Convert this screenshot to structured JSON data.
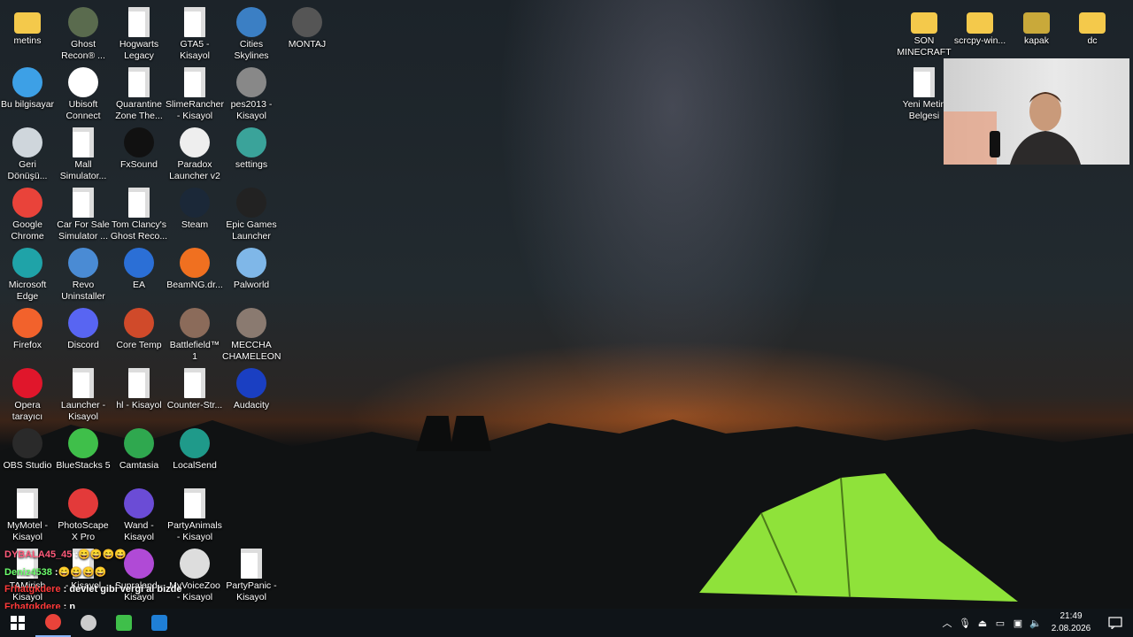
{
  "desktop_icons": [
    {
      "label": "metins",
      "icon": "folder-user-icon",
      "color": "#f4c94b"
    },
    {
      "label": "Ghost\nRecon® ...",
      "icon": "ghost-recon-icon",
      "color": "#5a6b4e"
    },
    {
      "label": "Hogwarts\nLegacy",
      "icon": "shortcut-file-icon",
      "color": "#ffffff"
    },
    {
      "label": "GTA5 -\nKisayol",
      "icon": "shortcut-file-icon",
      "color": "#ffffff"
    },
    {
      "label": "Cities\nSkylines",
      "icon": "cities-skylines-icon",
      "color": "#3b7fc4"
    },
    {
      "label": "MONTAJ",
      "icon": "montaj-icon",
      "color": "#555555"
    },
    {
      "label": "Bu bilgisayar",
      "icon": "computer-icon",
      "color": "#3da0e6"
    },
    {
      "label": "Ubisoft\nConnect",
      "icon": "ubisoft-icon",
      "color": "#ffffff"
    },
    {
      "label": "Quarantine\nZone The...",
      "icon": "shortcut-file-icon",
      "color": "#ffffff"
    },
    {
      "label": "SlimeRancher\n- Kisayol",
      "icon": "shortcut-file-icon",
      "color": "#ffffff"
    },
    {
      "label": "pes2013 -\nKisayol",
      "icon": "pes-icon",
      "color": "#888888"
    },
    {
      "label": "Geri\nDönüşü...",
      "icon": "recycle-bin-icon",
      "color": "#cfd6dc"
    },
    {
      "label": "Mall\nSimulator...",
      "icon": "shortcut-file-icon",
      "color": "#ffffff"
    },
    {
      "label": "FxSound",
      "icon": "fxsound-icon",
      "color": "#111111"
    },
    {
      "label": "Paradox\nLauncher v2",
      "icon": "paradox-icon",
      "color": "#eeeeee"
    },
    {
      "label": "settings",
      "icon": "settings-icon",
      "color": "#3aa39a"
    },
    {
      "label": "Google\nChrome",
      "icon": "chrome-icon",
      "color": "#e9433a"
    },
    {
      "label": "Car For Sale\nSimulator ...",
      "icon": "shortcut-file-icon",
      "color": "#ffffff"
    },
    {
      "label": "Tom Clancy's\nGhost Reco...",
      "icon": "shortcut-file-icon",
      "color": "#ffffff"
    },
    {
      "label": "Steam",
      "icon": "steam-icon",
      "color": "#1b2838"
    },
    {
      "label": "Epic Games\nLauncher",
      "icon": "epic-games-icon",
      "color": "#222222"
    },
    {
      "label": "Microsoft\nEdge",
      "icon": "edge-icon",
      "color": "#1fa3a8"
    },
    {
      "label": "Revo\nUninstaller",
      "icon": "revo-icon",
      "color": "#4a8bd4"
    },
    {
      "label": "EA",
      "icon": "ea-icon",
      "color": "#2b6fd6"
    },
    {
      "label": "BeamNG.dr...",
      "icon": "beamng-icon",
      "color": "#f07020"
    },
    {
      "label": "Palworld",
      "icon": "palworld-icon",
      "color": "#7fb7e8"
    },
    {
      "label": "Firefox",
      "icon": "firefox-icon",
      "color": "#f2622c"
    },
    {
      "label": "Discord",
      "icon": "discord-icon",
      "color": "#5865f2"
    },
    {
      "label": "Core Temp",
      "icon": "core-temp-icon",
      "color": "#d04a2a"
    },
    {
      "label": "Battlefield™\n1",
      "icon": "battlefield-icon",
      "color": "#8b6b5a"
    },
    {
      "label": "MECCHA\nCHAMELEON",
      "icon": "meccha-chameleon-icon",
      "color": "#8a7a70"
    },
    {
      "label": "Opera\ntarayıcı",
      "icon": "opera-icon",
      "color": "#e0162b"
    },
    {
      "label": "Launcher -\nKisayol",
      "icon": "shortcut-file-icon",
      "color": "#ffffff"
    },
    {
      "label": "hl - Kisayol",
      "icon": "shortcut-file-icon",
      "color": "#ffffff"
    },
    {
      "label": "Counter-Str...",
      "icon": "shortcut-file-icon",
      "color": "#ffffff"
    },
    {
      "label": "Audacity",
      "icon": "audacity-icon",
      "color": "#1a3fc2"
    },
    {
      "label": "OBS Studio",
      "icon": "obs-icon",
      "color": "#2a2a2a"
    },
    {
      "label": "BlueStacks 5",
      "icon": "bluestacks-icon",
      "color": "#3fbf4a"
    },
    {
      "label": "Camtasia",
      "icon": "camtasia-icon",
      "color": "#2fa84f"
    },
    {
      "label": "LocalSend",
      "icon": "localsend-icon",
      "color": "#1f9a8a"
    },
    {
      "label": "MyMotel -\nKisayol",
      "icon": "shortcut-file-icon",
      "color": "#ffffff"
    },
    {
      "label": "PhotoScape\nX Pro",
      "icon": "photoscape-icon",
      "color": "#e33a3a"
    },
    {
      "label": "Wand -\nKisayol",
      "icon": "wand-icon",
      "color": "#6b4cd6"
    },
    {
      "label": "PartyAnimals\n- Kisayol",
      "icon": "shortcut-file-icon",
      "color": "#ffffff"
    },
    {
      "label": "TAMirish\nKisayol",
      "icon": "shortcut-file-icon",
      "color": "#ffffff"
    },
    {
      "label": "- Kisayol",
      "icon": "shortcut-file-icon",
      "color": "#ffffff"
    },
    {
      "label": "Supraland -\nKisayol",
      "icon": "supraland-icon",
      "color": "#b04ad6"
    },
    {
      "label": "MyVoiceZoo\n- Kisayol",
      "icon": "myvoicezoo-icon",
      "color": "#dddddd"
    },
    {
      "label": "PartyPanic -\nKisayol",
      "icon": "shortcut-file-icon",
      "color": "#ffffff"
    },
    {
      "label": "SON\nMINECRAFT",
      "icon": "folder-icon",
      "color": "#f4c94b"
    },
    {
      "label": "scrcpy-win...",
      "icon": "folder-icon",
      "color": "#f4c94b"
    },
    {
      "label": "kapak",
      "icon": "folder-image-icon",
      "color": "#c9a93a"
    },
    {
      "label": "dc",
      "icon": "folder-icon",
      "color": "#f4c94b"
    },
    {
      "label": "Yeni Metin\nBelgesi",
      "icon": "text-document-icon",
      "color": "#ffffff"
    }
  ],
  "chat": [
    {
      "user": "DYBALA45_45",
      "text": ":",
      "user_color": "#ff5a7a",
      "emotes": "😄😄😄😄"
    },
    {
      "user": "Deniz4538",
      "text": ":",
      "user_color": "#6cff6c",
      "emotes": "😄😄😄😄"
    },
    {
      "user": "Frhatgkdere",
      "text": ": devlet gibi vergi al bizde",
      "user_color": "#ff3a3a",
      "emotes": ""
    },
    {
      "user": "Frhatgkdere",
      "text": ": n",
      "user_color": "#ff3a3a",
      "emotes": ""
    },
    {
      "user": "Frhatgkdere",
      "text": ":",
      "user_color": "#ff3a3a",
      "emotes": "😎😎"
    }
  ],
  "taskbar": {
    "start_icon": "windows-start-icon",
    "apps": [
      {
        "name": "chrome-icon",
        "color": "#e9433a"
      },
      {
        "name": "obs-icon",
        "color": "#cccccc"
      },
      {
        "name": "bluestacks-icon",
        "color": "#3fbf4a"
      },
      {
        "name": "vscode-like-icon",
        "color": "#1f7fd6"
      }
    ],
    "tray_icons": [
      "chevron-up-icon",
      "microphone-icon",
      "usb-icon",
      "battery-icon",
      "network-icon",
      "volume-icon"
    ],
    "time": "21:49",
    "date": "2.08.2026",
    "notification_icon": "notification-icon"
  },
  "colors": {
    "taskbar": "#0f1418",
    "tent": "#8fe23a"
  }
}
